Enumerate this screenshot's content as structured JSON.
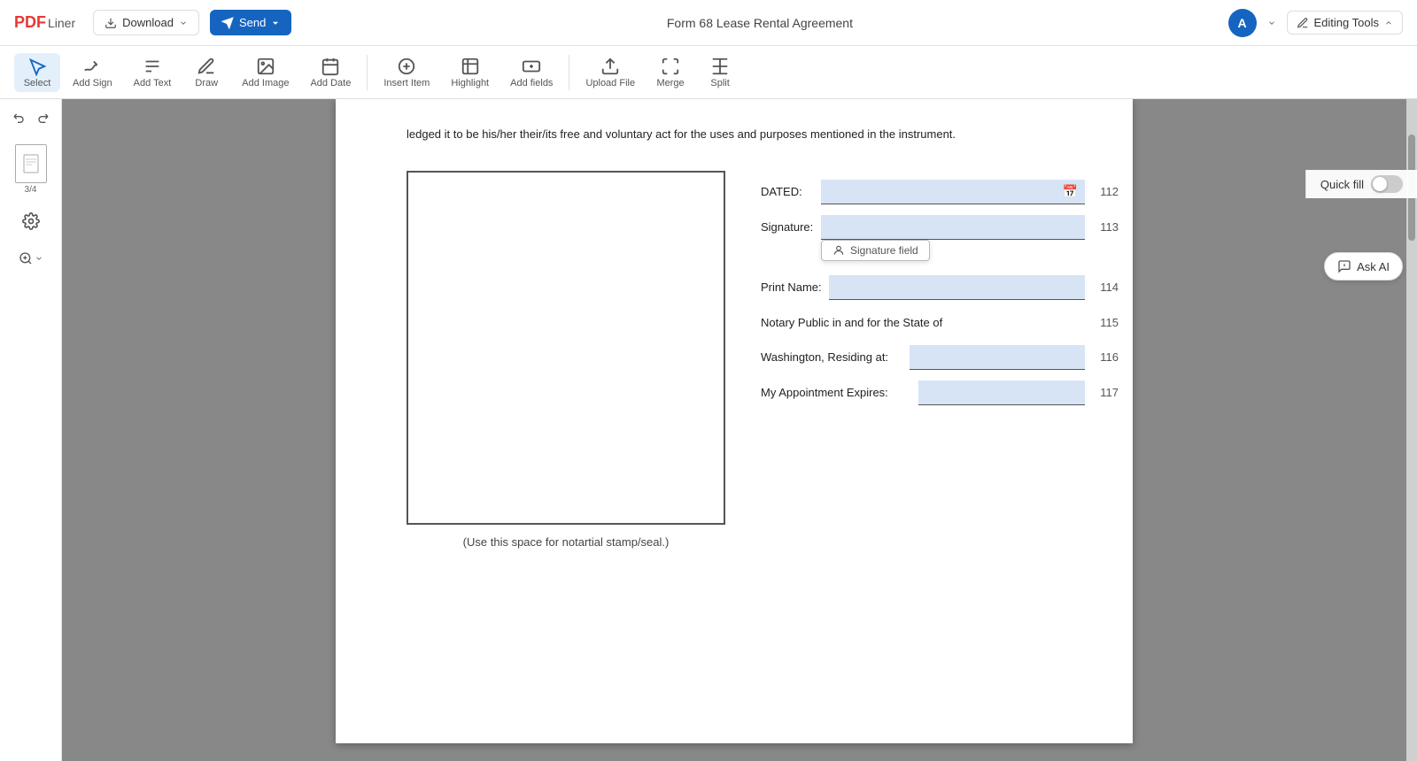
{
  "app": {
    "logo_pdf": "PDF",
    "logo_liner": "Liner",
    "document_title": "Form 68 Lease Rental Agreement"
  },
  "toolbar": {
    "download_label": "Download",
    "send_label": "Send",
    "editing_tools_label": "Editing Tools"
  },
  "icon_tools": [
    {
      "id": "select",
      "label": "Select",
      "active": true
    },
    {
      "id": "add-sign",
      "label": "Add Sign",
      "active": false
    },
    {
      "id": "add-text",
      "label": "Add Text",
      "active": false
    },
    {
      "id": "draw",
      "label": "Draw",
      "active": false
    },
    {
      "id": "add-image",
      "label": "Add Image",
      "active": false
    },
    {
      "id": "add-date",
      "label": "Add Date",
      "active": false
    },
    {
      "id": "insert-item",
      "label": "Insert Item",
      "active": false
    },
    {
      "id": "highlight",
      "label": "Highlight",
      "active": false
    },
    {
      "id": "add-fields",
      "label": "Add fields",
      "active": false
    },
    {
      "id": "upload-file",
      "label": "Upload File",
      "active": false
    },
    {
      "id": "merge",
      "label": "Merge",
      "active": false
    },
    {
      "id": "split",
      "label": "Split",
      "active": false
    }
  ],
  "sidebar": {
    "page_num": "3/4"
  },
  "quick_fill": {
    "label": "Quick fill"
  },
  "document": {
    "top_text": "ledged it to be his/her their/its free and voluntary act for the uses and purposes mentioned in the instrument.",
    "stamp_label": "(Use this space for notartial stamp/seal.)",
    "fields": [
      {
        "label": "DATED:",
        "line_num": "112",
        "type": "date",
        "has_calendar": true
      },
      {
        "label": "Signature:",
        "line_num": "113",
        "type": "signature",
        "placeholder": "Signature field"
      },
      {
        "label": "Print Name:",
        "line_num": "114",
        "type": "text"
      },
      {
        "label": "Notary Public in and for the State of",
        "line_num": "115",
        "type": "static"
      },
      {
        "label": "Washington, Residing at:",
        "line_num": "116",
        "type": "text"
      },
      {
        "label": "My Appointment Expires:",
        "line_num": "117",
        "type": "text"
      }
    ]
  },
  "ask_ai": {
    "label": "Ask AI"
  },
  "colors": {
    "accent_blue": "#1565c0",
    "field_bg": "#d6e4f5",
    "toolbar_bg": "#ffffff"
  }
}
